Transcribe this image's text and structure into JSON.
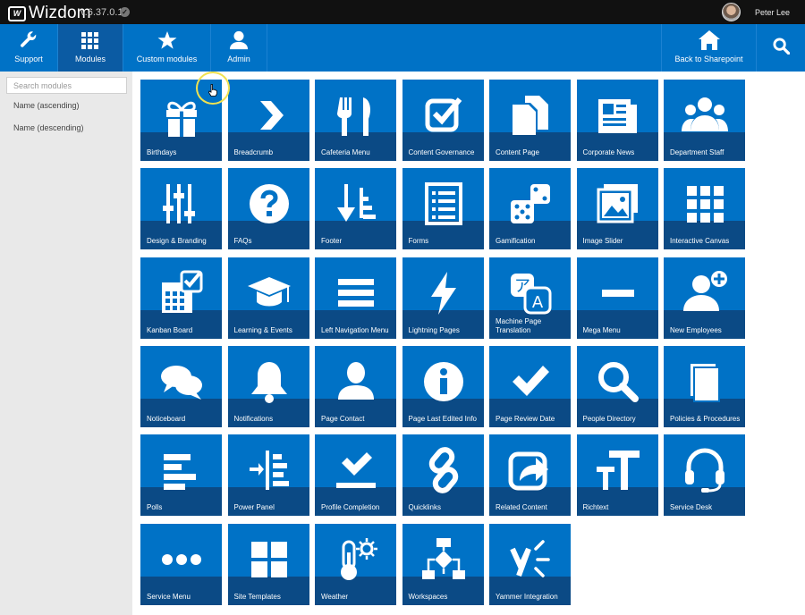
{
  "topbar": {
    "logo_mark": "W",
    "app_name": "Wizdom",
    "version": "v.6.37.0.1",
    "user_name": "Peter Lee"
  },
  "nav": {
    "support": "Support",
    "modules": "Modules",
    "custom_modules": "Custom modules",
    "admin": "Admin",
    "back": "Back to Sharepoint"
  },
  "sidebar": {
    "search_placeholder": "Search modules",
    "sort_ascending": "Name (ascending)",
    "sort_descending": "Name (descending)"
  },
  "colors": {
    "nav_bg": "#0072c6",
    "nav_active": "#0b5ba3",
    "tile_bg": "#0072c6",
    "tile_band": "#0b4a85",
    "topbar_bg": "#111111",
    "sidebar_bg": "#e9e9e9"
  },
  "modules": [
    {
      "label": "Birthdays",
      "icon": "gift-icon"
    },
    {
      "label": "Breadcrumb",
      "icon": "chevron-right-icon"
    },
    {
      "label": "Cafeteria Menu",
      "icon": "fork-knife-icon"
    },
    {
      "label": "Content Governance",
      "icon": "checkbox-icon"
    },
    {
      "label": "Content Page",
      "icon": "documents-icon"
    },
    {
      "label": "Corporate News",
      "icon": "newspaper-icon"
    },
    {
      "label": "Department Staff",
      "icon": "group-icon"
    },
    {
      "label": "Design & Branding",
      "icon": "sliders-icon"
    },
    {
      "label": "FAQs",
      "icon": "question-icon"
    },
    {
      "label": "Footer",
      "icon": "footer-arrow-icon"
    },
    {
      "label": "Forms",
      "icon": "form-icon"
    },
    {
      "label": "Gamification",
      "icon": "dice-icon"
    },
    {
      "label": "Image Slider",
      "icon": "image-icon"
    },
    {
      "label": "Interactive Canvas",
      "icon": "grid-icon"
    },
    {
      "label": "Kanban Board",
      "icon": "calendar-check-icon"
    },
    {
      "label": "Learning & Events",
      "icon": "graduation-cap-icon"
    },
    {
      "label": "Left Navigation Menu",
      "icon": "menu-lines-icon"
    },
    {
      "label": "Lightning Pages",
      "icon": "lightning-icon"
    },
    {
      "label": "Machine Page Translation",
      "icon": "translate-icon"
    },
    {
      "label": "Mega Menu",
      "icon": "minus-icon"
    },
    {
      "label": "New Employees",
      "icon": "add-user-icon"
    },
    {
      "label": "Noticeboard",
      "icon": "chat-bubbles-icon"
    },
    {
      "label": "Notifications",
      "icon": "bell-icon"
    },
    {
      "label": "Page Contact",
      "icon": "person-icon"
    },
    {
      "label": "Page Last Edited Info",
      "icon": "info-icon"
    },
    {
      "label": "Page Review Date",
      "icon": "checkmark-icon"
    },
    {
      "label": "People Directory",
      "icon": "magnifier-icon"
    },
    {
      "label": "Policies & Procedures",
      "icon": "book-icon"
    },
    {
      "label": "Polls",
      "icon": "bars-icon"
    },
    {
      "label": "Power Panel",
      "icon": "panel-icon"
    },
    {
      "label": "Profile Completion",
      "icon": "check-line-icon"
    },
    {
      "label": "Quicklinks",
      "icon": "link-icon"
    },
    {
      "label": "Related Content",
      "icon": "share-icon"
    },
    {
      "label": "Richtext",
      "icon": "text-size-icon"
    },
    {
      "label": "Service Desk",
      "icon": "headset-icon"
    },
    {
      "label": "Service Menu",
      "icon": "dots-icon"
    },
    {
      "label": "Site Templates",
      "icon": "template-icon"
    },
    {
      "label": "Weather",
      "icon": "thermometer-sun-icon"
    },
    {
      "label": "Workspaces",
      "icon": "flowchart-icon"
    },
    {
      "label": "Yammer Integration",
      "icon": "yammer-icon"
    }
  ]
}
